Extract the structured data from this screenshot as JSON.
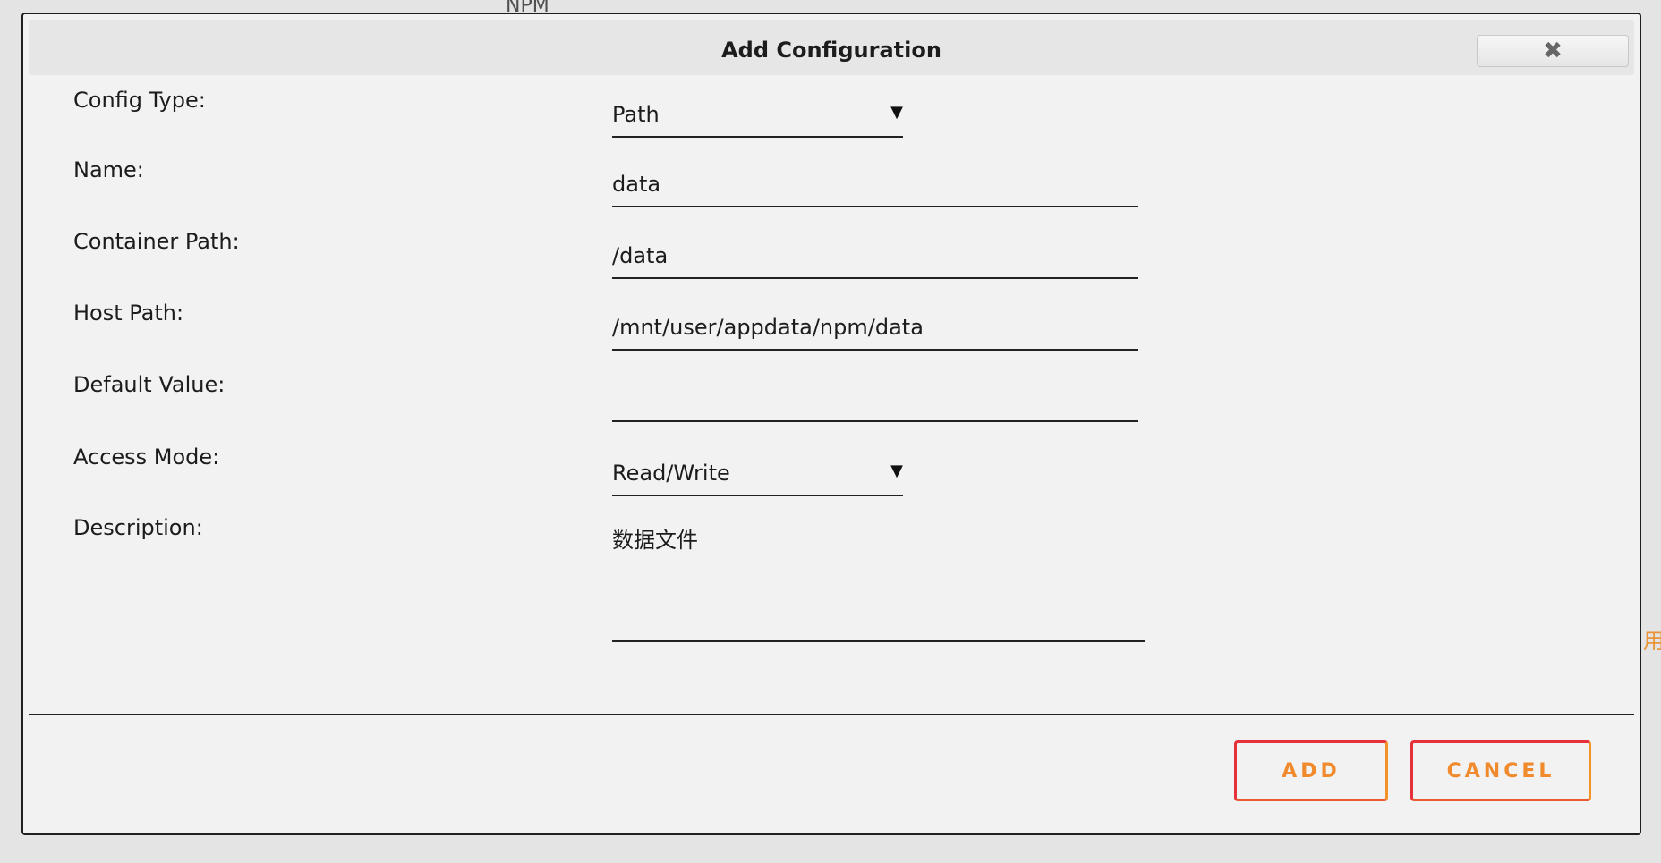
{
  "background": {
    "top_text": "NPM",
    "right_text": "用"
  },
  "dialog": {
    "title": "Add Configuration",
    "close_icon": "close-icon"
  },
  "form": {
    "config_type": {
      "label": "Config Type:",
      "value": "Path"
    },
    "name": {
      "label": "Name:",
      "value": "data"
    },
    "container_path": {
      "label": "Container Path:",
      "value": "/data"
    },
    "host_path": {
      "label": "Host Path:",
      "value": "/mnt/user/appdata/npm/data"
    },
    "default_value": {
      "label": "Default Value:",
      "value": ""
    },
    "access_mode": {
      "label": "Access Mode:",
      "value": "Read/Write"
    },
    "description": {
      "label": "Description:",
      "value": "数据文件"
    }
  },
  "buttons": {
    "add": "ADD",
    "cancel": "CANCEL"
  },
  "colors": {
    "button_border_start": "#e5323a",
    "button_border_end": "#f39227",
    "button_text": "#f08a2d"
  }
}
